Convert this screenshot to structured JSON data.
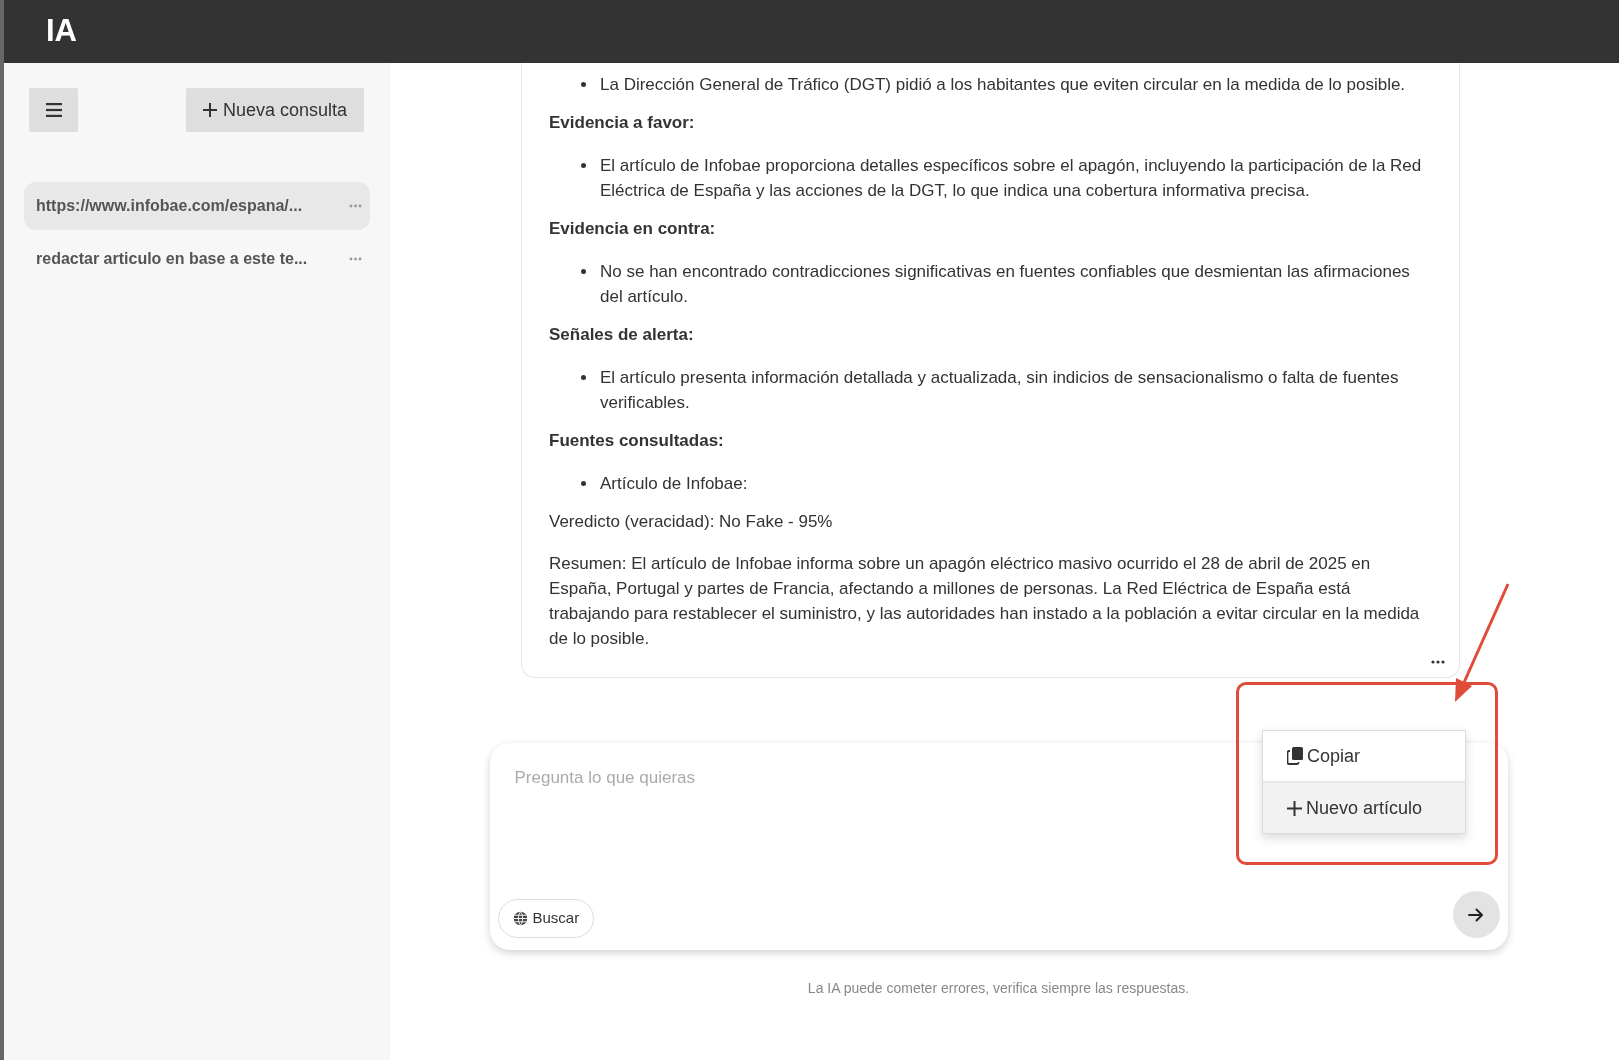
{
  "app": {
    "title": "IA"
  },
  "sidebar": {
    "new_button": "Nueva consulta",
    "items": [
      {
        "label": "https://www.infobae.com/espana/...",
        "selected": true
      },
      {
        "label": "redactar articulo en base a este te...",
        "selected": false
      }
    ]
  },
  "message": {
    "blocks": [
      {
        "kind": "list",
        "items": [
          "La Dirección General de Tráfico (DGT) pidió a los habitantes que eviten circular en la medida de lo posible."
        ]
      },
      {
        "kind": "heading",
        "text": "Evidencia a favor:"
      },
      {
        "kind": "list",
        "items": [
          "El artículo de Infobae proporciona detalles específicos sobre el apagón, incluyendo la participación de la Red Eléctrica de España y las acciones de la DGT, lo que indica una cobertura informativa precisa."
        ]
      },
      {
        "kind": "heading",
        "text": "Evidencia en contra:"
      },
      {
        "kind": "list",
        "items": [
          "No se han encontrado contradicciones significativas en fuentes confiables que desmientan las afirmaciones del artículo."
        ]
      },
      {
        "kind": "heading",
        "text": "Señales de alerta:"
      },
      {
        "kind": "list",
        "items": [
          "El artículo presenta información detallada y actualizada, sin indicios de sensacionalismo o falta de fuentes verificables."
        ]
      },
      {
        "kind": "heading",
        "text": "Fuentes consultadas:"
      },
      {
        "kind": "list",
        "items": [
          "Artículo de Infobae:"
        ]
      },
      {
        "kind": "paragraph",
        "text": "Veredicto (veracidad): No Fake - 95%"
      },
      {
        "kind": "paragraph",
        "text": "Resumen: El artículo de Infobae informa sobre un apagón eléctrico masivo ocurrido el 28 de abril de 2025 en España, Portugal y partes de Francia, afectando a millones de personas. La Red Eléctrica de España está trabajando para restablecer el suministro, y las autoridades han instado a la población a evitar circular en la medida de lo posible."
      }
    ]
  },
  "menu": {
    "items": [
      {
        "kind": "copy",
        "label": "Copiar",
        "selected": false
      },
      {
        "kind": "new",
        "label": "Nuevo artículo",
        "selected": true
      }
    ]
  },
  "composer": {
    "placeholder": "Pregunta lo que quieras",
    "search_button": "Buscar"
  },
  "footer": "La IA puede cometer errores, verifica siempre las respuestas."
}
